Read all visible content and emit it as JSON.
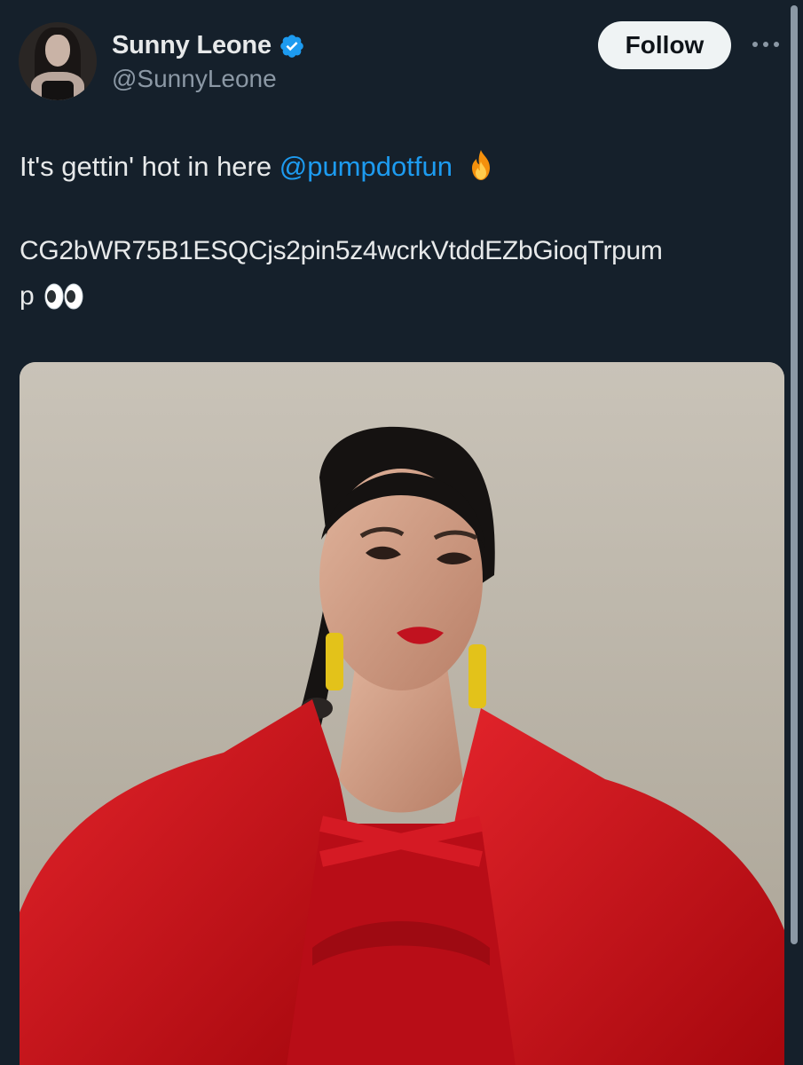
{
  "post": {
    "author": {
      "display_name": "Sunny Leone",
      "handle": "@SunnyLeone",
      "verified": true
    },
    "follow_label": "Follow",
    "text": {
      "line1_prefix": "It's gettin' hot in here ",
      "mention": "@pumpdotfun",
      "line2": "CG2bWR75B1ESQCjs2pin5z4wcrkVtddEZbGioqTrpum",
      "line3": "p"
    },
    "emojis": [
      "fire-emoji",
      "eyes-emoji"
    ],
    "media": {
      "icon": "photo"
    }
  },
  "colors": {
    "background": "#15202b",
    "text_primary": "#e7e9ea",
    "text_secondary": "#8b98a5",
    "link": "#1d9bf0",
    "follow_button_bg": "#eff3f4",
    "verified": "#1d9bf0"
  }
}
